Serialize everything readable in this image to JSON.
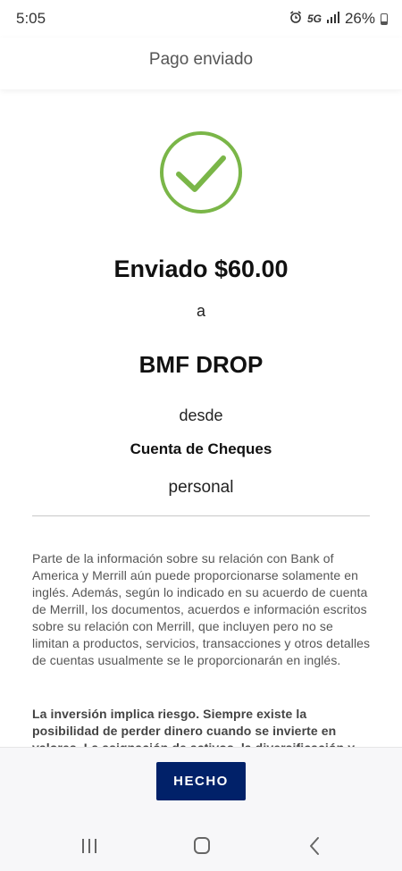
{
  "status_bar": {
    "time": "5:05",
    "network": "5G",
    "battery": "26%"
  },
  "header": {
    "title": "Pago enviado"
  },
  "confirmation": {
    "check_icon": "check-circle-icon",
    "accent_color": "#7ab648",
    "amount_text": "Enviado $60.00",
    "to_word": "a",
    "payee": "BMF DROP",
    "from_word": "desde",
    "account_name": "Cuenta de Cheques",
    "account_type": "personal"
  },
  "disclosure": {
    "text": "Parte de la información sobre su relación con Bank of America y Merrill aún puede proporcionarse solamente en inglés. Además, según lo indicado en su acuerdo de cuenta de Merrill, los documentos, acuerdos e información escritos sobre su relación con Merrill, que incluyen pero no se limitan a productos, servicios, transacciones y otros detalles de cuentas usualmente se le proporcionarán en inglés.",
    "risk_text": "La inversión implica riesgo. Siempre existe la posibilidad de perder dinero cuando se invierte en valores. La asignación de activos, la diversificación y"
  },
  "actions": {
    "done_label": "HECHO",
    "button_color": "#012169"
  },
  "nav": {
    "recents_icon": "recents-icon",
    "home_icon": "home-icon",
    "back_icon": "back-icon"
  }
}
